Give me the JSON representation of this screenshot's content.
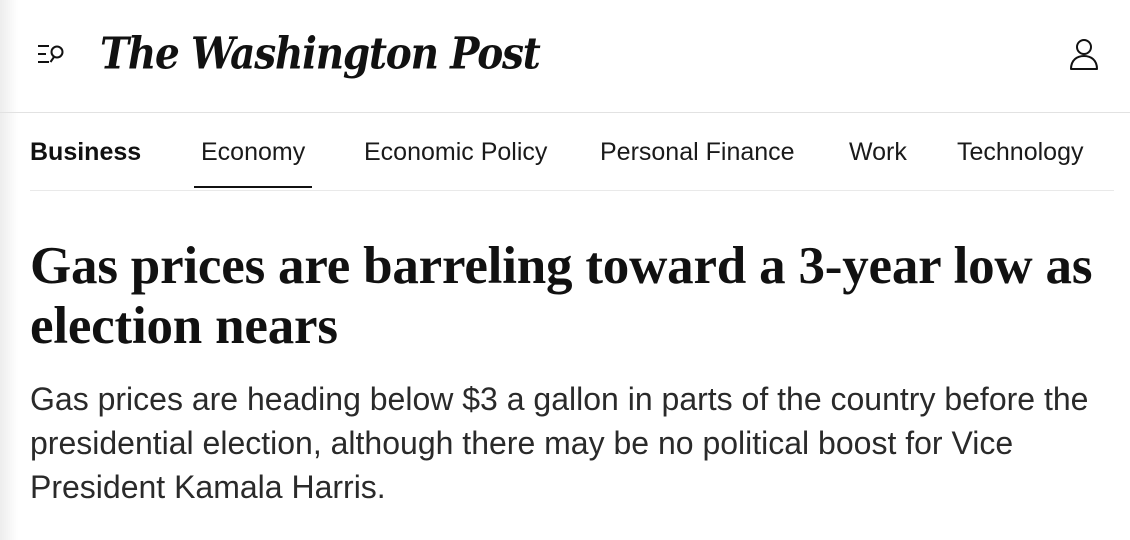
{
  "masthead": {
    "logo_text": "The Washington Post",
    "menu_icon": "menu-search-icon",
    "account_icon": "user-icon"
  },
  "section_nav": {
    "section_title": "Business",
    "items": [
      {
        "label": "Economy",
        "active": true
      },
      {
        "label": "Economic Policy",
        "active": false
      },
      {
        "label": "Personal Finance",
        "active": false
      },
      {
        "label": "Work",
        "active": false
      },
      {
        "label": "Technology",
        "active": false
      }
    ]
  },
  "article": {
    "headline": "Gas prices are barreling toward a 3-year low as election nears",
    "dek": "Gas prices are heading below $3 a gallon in parts of the country before the presidential election, although there may be no political boost for Vice President Kamala Harris."
  },
  "colors": {
    "text": "#111111",
    "divider": "#e2e2e2",
    "background": "#ffffff"
  }
}
